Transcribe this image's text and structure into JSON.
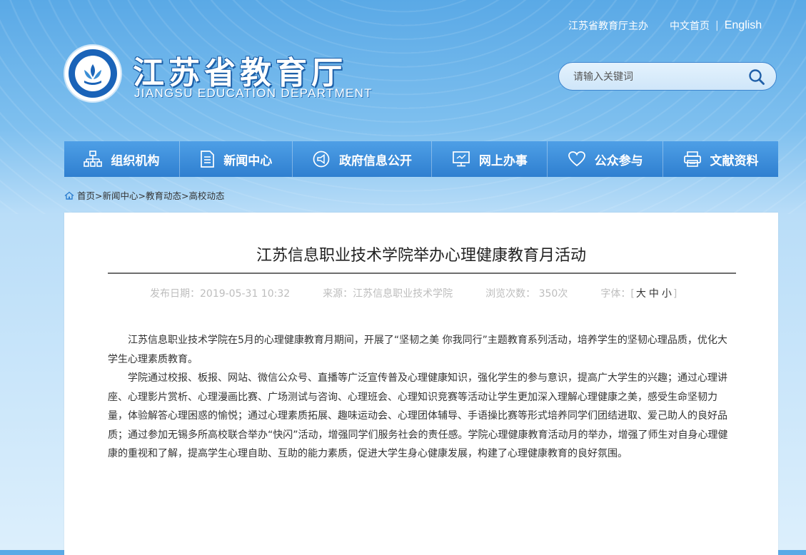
{
  "header": {
    "top_links": {
      "sponsor": "江苏省教育厅主办",
      "home_cn": "中文首页",
      "separator": "|",
      "english": "English"
    },
    "logo": {
      "title": "江苏省教育厅",
      "subtitle": "JIANGSU EDUCATION DEPARTMENT"
    },
    "search": {
      "placeholder": "请输入关键词"
    }
  },
  "nav": {
    "items": [
      {
        "label": "组织机构",
        "icon": "org-chart-icon"
      },
      {
        "label": "新闻中心",
        "icon": "document-icon"
      },
      {
        "label": "政府信息公开",
        "icon": "megaphone-icon"
      },
      {
        "label": "网上办事",
        "icon": "monitor-icon"
      },
      {
        "label": "公众参与",
        "icon": "heart-icon"
      },
      {
        "label": "文献资料",
        "icon": "printer-icon"
      }
    ]
  },
  "breadcrumb": {
    "items": [
      "首页>",
      "新闻中心>",
      "教育动态>",
      "高校动态"
    ]
  },
  "article": {
    "title": "江苏信息职业技术学院举办心理健康教育月活动",
    "meta": {
      "date": "发布日期：2019-05-31 10:32",
      "source": "来源：江苏信息职业技术学院",
      "views": "浏览次数： 350次",
      "font_label": "字体：[",
      "font_large": "大",
      "font_medium": "中",
      "font_small": "小",
      "font_close": "]"
    },
    "paragraphs": [
      "江苏信息职业技术学院在5月的心理健康教育月期间，开展了“坚韧之美 你我同行”主题教育系列活动，培养学生的坚韧心理品质，优化大学生心理素质教育。",
      "学院通过校报、板报、网站、微信公众号、直播等广泛宣传普及心理健康知识，强化学生的参与意识，提高广大学生的兴趣；通过心理讲座、心理影片赏析、心理漫画比赛、广场测试与咨询、心理班会、心理知识竞赛等活动让学生更加深入理解心理健康之美，感受生命坚韧力量，体验解答心理困惑的愉悦；通过心理素质拓展、趣味运动会、心理团体辅导、手语操比赛等形式培养同学们团结进取、爱己助人的良好品质；通过参加无锡多所高校联合举办“快闪”活动，增强同学们服务社会的责任感。学院心理健康教育活动月的举办，增强了师生对自身心理健康的重视和了解，提高学生心理自助、互助的能力素质，促进大学生身心健康发展，构建了心理健康教育的良好氛围。"
    ]
  },
  "colors": {
    "nav_blue": "#3a8bd9",
    "header_blue": "#5aa9e6",
    "emblem_blue": "#1a63b8"
  }
}
